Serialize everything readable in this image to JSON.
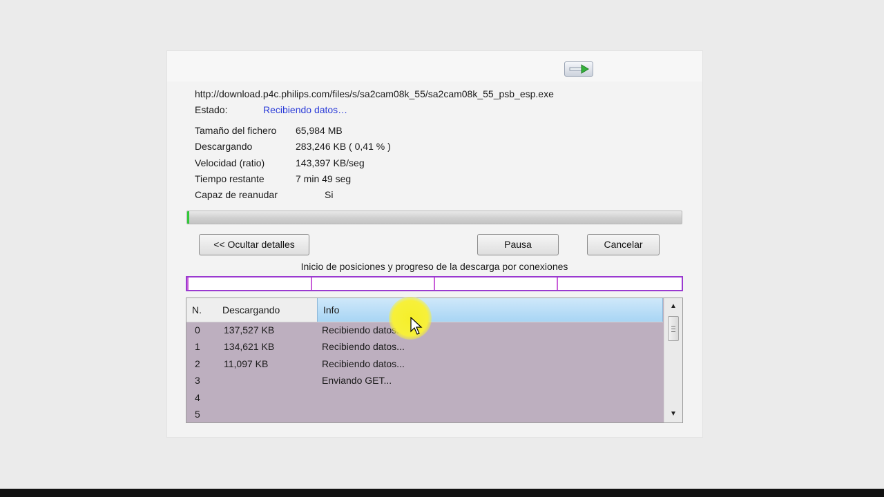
{
  "download": {
    "url": "http://download.p4c.philips.com/files/s/sa2cam08k_55/sa2cam08k_55_psb_esp.exe",
    "status_label": "Estado:",
    "status_value": "Recibiendo datos…"
  },
  "details": [
    {
      "label": "Tamaño del fichero",
      "value": "65,984  MB"
    },
    {
      "label": "Descargando",
      "value": "283,246  KB  ( 0,41 % )"
    },
    {
      "label": "Velocidad (ratio)",
      "value": "143,397  KB/seg"
    },
    {
      "label": "Tiempo restante",
      "value": "7 min  49 seg"
    },
    {
      "label": "Capaz de reanudar",
      "value": "Si"
    }
  ],
  "progress_fraction": 0.0041,
  "buttons": {
    "hide_details": "<< Ocultar detalles",
    "pause": "Pausa",
    "cancel": "Cancelar"
  },
  "connections_label": "Inicio de posiciones y progreso de la descarga por conexiones",
  "connections_table": {
    "columns": [
      "N.",
      "Descargando",
      "Info"
    ],
    "rows": [
      {
        "n": "0",
        "downloaded": "137,527 KB",
        "info": "Recibiendo datos..."
      },
      {
        "n": "1",
        "downloaded": "134,621 KB",
        "info": "Recibiendo datos..."
      },
      {
        "n": "2",
        "downloaded": "11,097 KB",
        "info": "Recibiendo datos..."
      },
      {
        "n": "3",
        "downloaded": "",
        "info": "Enviando GET..."
      },
      {
        "n": "4",
        "downloaded": "",
        "info": ""
      },
      {
        "n": "5",
        "downloaded": "",
        "info": ""
      }
    ]
  },
  "icons": {
    "minimize_arrow": "arrow-right-icon",
    "scroll_up": "chevron-up-icon",
    "scroll_down": "chevron-down-icon",
    "pointer": "mouse-cursor-icon"
  },
  "colors": {
    "status_value": "#2a3bd8",
    "progress_fill": "#32c83a",
    "connection_border": "#9a3ad0",
    "table_background": "#bdafbf",
    "header_highlight": "#a8d5f4",
    "cursor_highlight": "#f5ef2a"
  }
}
